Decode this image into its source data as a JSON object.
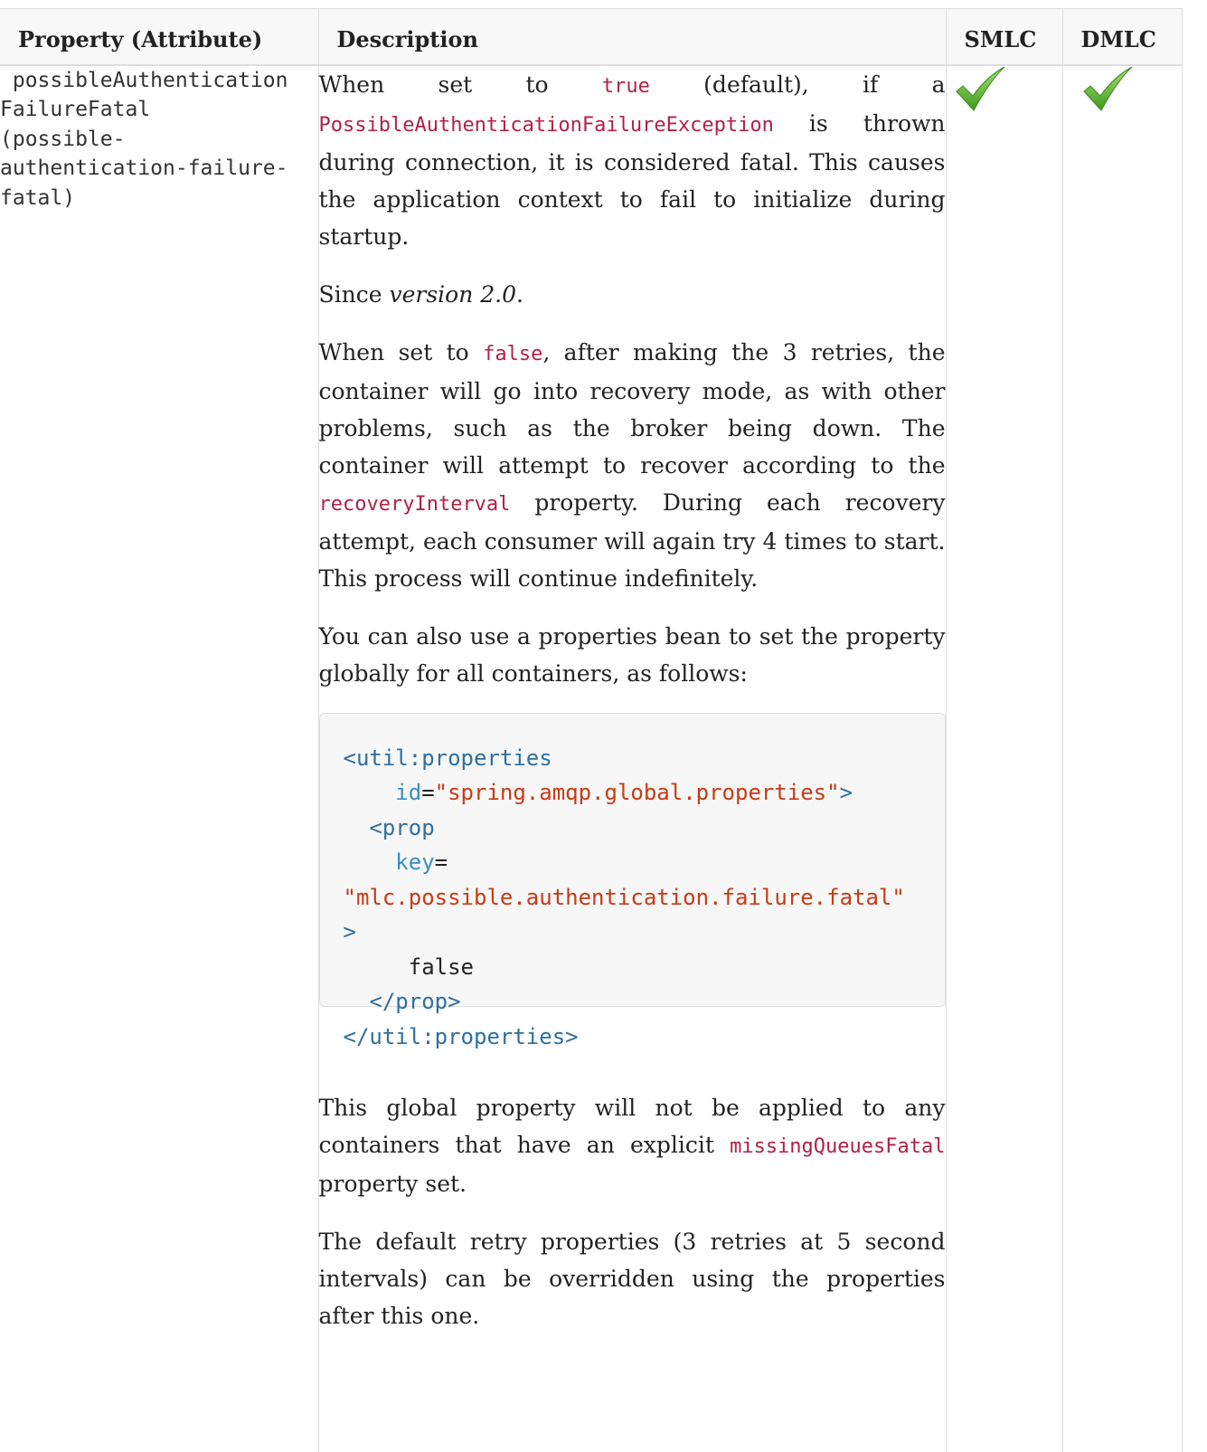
{
  "table": {
    "headers": {
      "property": "Property (Attribute)",
      "description": "Description",
      "smlc": "SMLC",
      "dmlc": "DMLC"
    },
    "row": {
      "property_lines": [
        " possibleAuthentication",
        "FailureFatal",
        "(possible-",
        "authentication-failure-",
        "fatal)"
      ],
      "p1": {
        "t1": "When set to ",
        "code1": "true",
        "t2": " (default), if a ",
        "code2": "PossibleAuthenticationFailureException",
        "t3": " is thrown during connection, it is considered fatal. This causes the application context to fail to initialize during startup."
      },
      "p2": {
        "t1": "Since ",
        "em": "version 2.0",
        "t2": "."
      },
      "p3": {
        "t1": "When set to ",
        "code1": "false",
        "t2": ", after making the 3 retries, the container will go into recovery mode, as with other problems, such as the broker being down. The container will attempt to recover according to the ",
        "code2": "recoveryInterval",
        "t3": " property. During each recovery attempt, each consumer will again try 4 times to start. This process will continue indefinitely."
      },
      "p4": "You can also use a properties bean to set the property globally for all containers, as follows:",
      "code_block": {
        "l1_tag": "<util:properties",
        "l2_attr": "id",
        "l2_eq": "=",
        "l2_val": "\"spring.amqp.global.properties\"",
        "l2_close": ">",
        "l3_tag": "<prop",
        "l4_attr": "key",
        "l4_eq": "=",
        "l5_val": "\"mlc.possible.authentication.failure.fatal\"",
        "l6_close": ">",
        "l7_text": "false",
        "l8_tag": "</prop>",
        "l9_tag": "</util:properties>"
      },
      "p5": {
        "t1": "This global property will not be applied to any containers that have an explicit ",
        "code1": "missingQueuesFatal",
        "t2": " property set."
      },
      "p6": "The default retry properties (3 retries at 5 second intervals) can be overridden using the properties after this one.",
      "smlc_icon": "green-checkmark-icon",
      "dmlc_icon": "green-checkmark-icon"
    }
  },
  "colors": {
    "code_text": "#b12146",
    "check_green": "#5cb82a",
    "header_bg": "#f7f8f7",
    "border": "#dedede"
  }
}
